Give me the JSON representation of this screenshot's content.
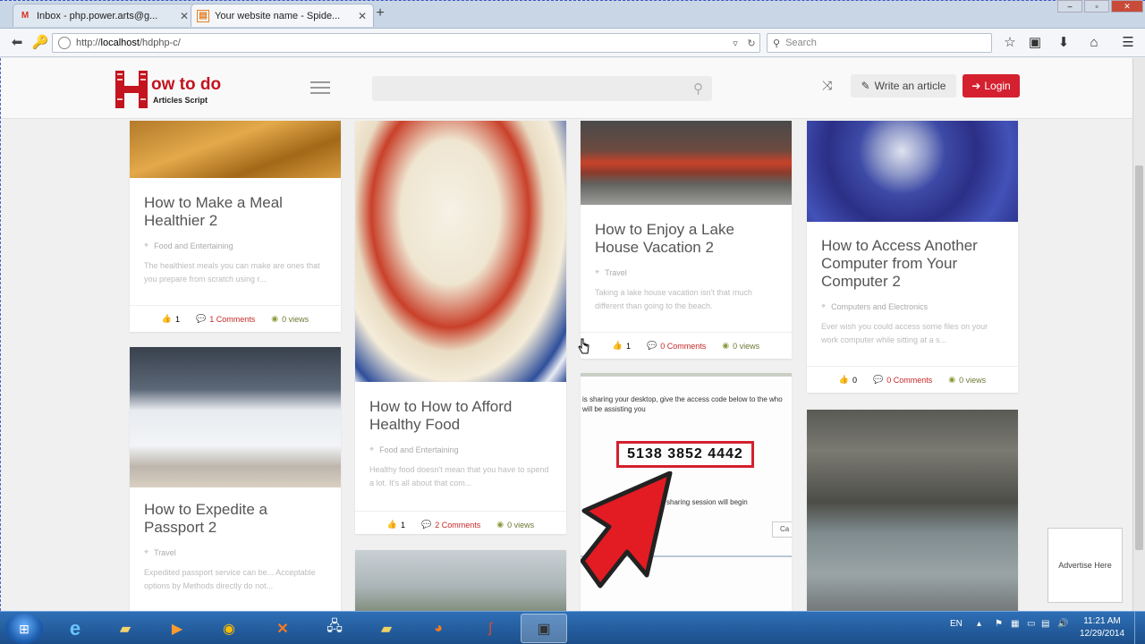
{
  "browser": {
    "tabs": [
      {
        "label": "Inbox - php.power.arts@g...",
        "icon": "gmail-icon",
        "active": false
      },
      {
        "label": "Your website name - Spide...",
        "icon": "site-favicon-icon",
        "active": true
      }
    ],
    "new_tab": "+",
    "url_prefix": "http://",
    "url_host": "localhost",
    "url_path": "/hdphp-c/",
    "search_placeholder": "Search"
  },
  "site": {
    "logo_text": "ow to do",
    "logo_subtitle": "Articles Script",
    "write_label": "Write an article",
    "login_label": "Login"
  },
  "cards": [
    {
      "title": "How to Make a Meal Healthier 2",
      "category": "Food and Entertaining",
      "desc": "The healthiest meals you can make are ones that you prepare from scratch using r...",
      "likes": "1",
      "comments": "1 Comments",
      "views": "0 views"
    },
    {
      "title": "How to How to Afford Healthy Food",
      "category": "Food and Entertaining",
      "desc": "Healthy food doesn't mean that you have to spend a lot. It's all about that com...",
      "likes": "1",
      "comments": "2 Comments",
      "views": "0 views"
    },
    {
      "title": "How to Enjoy a Lake House Vacation 2",
      "category": "Travel",
      "desc": "Taking a lake house vacation isn't that much different than going to the beach.",
      "likes": "1",
      "comments": "0 Comments",
      "views": "0 views"
    },
    {
      "title": "How to Access Another Computer from Your Computer 2",
      "category": "Computers and Electronics",
      "desc": "Ever wish you could access some files on your work computer while sitting at a s...",
      "likes": "0",
      "comments": "0 Comments",
      "views": "0 views"
    },
    {
      "title": "How to Expedite a Passport 2",
      "category": "Travel",
      "desc": "Expedited passport service can be... Acceptable options by Methods directly do not...",
      "likes": "",
      "comments": "",
      "views": ""
    }
  ],
  "remote_image": {
    "caption": "is sharing your desktop, give the access code below to the who will be assisting you",
    "code": "5138  3852  4442",
    "session_text": "sharing session will begin",
    "button_fragment": "Ca"
  },
  "advertise": "Advertise Here",
  "taskbar": {
    "lang": "EN",
    "time": "11:21 AM",
    "date": "12/29/2014"
  }
}
